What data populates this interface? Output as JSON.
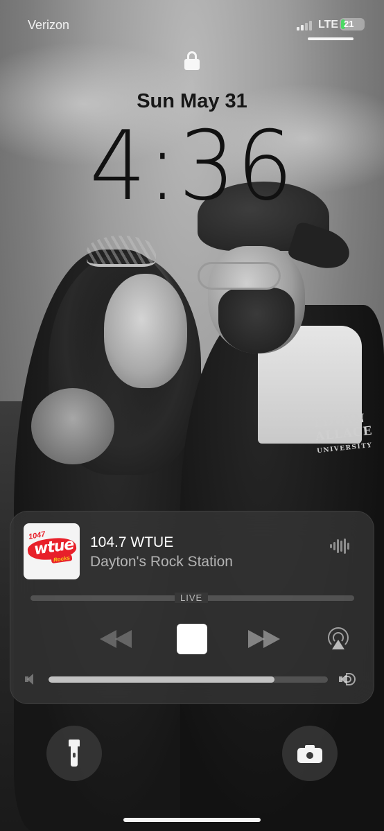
{
  "status_bar": {
    "carrier": "Verizon",
    "network": "LTE",
    "battery_level": "21",
    "battery_color": "#4cd964"
  },
  "lock_screen": {
    "lock_icon": "lock-icon",
    "date": "Sun May 31",
    "time": "4:36"
  },
  "wallpaper": {
    "jacket_text_line1": "LDWIN",
    "jacket_text_line2": "ALLACE",
    "jacket_text_line3": "UNIVERSITY"
  },
  "now_playing": {
    "artwork_logo_number": "1047",
    "artwork_logo_call": "wtue",
    "artwork_logo_tag": "Rocks",
    "title": "104.7 WTUE",
    "subtitle": "Dayton's Rock Station",
    "live_label": "LIVE",
    "volume_level": 0.81,
    "icons": {
      "waveform": "waveform-icon",
      "rewind": "rewind-icon",
      "stop": "stop-icon",
      "forward": "fast-forward-icon",
      "airplay": "airplay-icon",
      "volume_low": "volume-low-icon",
      "volume_high": "volume-high-icon"
    }
  },
  "quick_actions": {
    "flashlight": "flashlight-icon",
    "camera": "camera-icon"
  }
}
